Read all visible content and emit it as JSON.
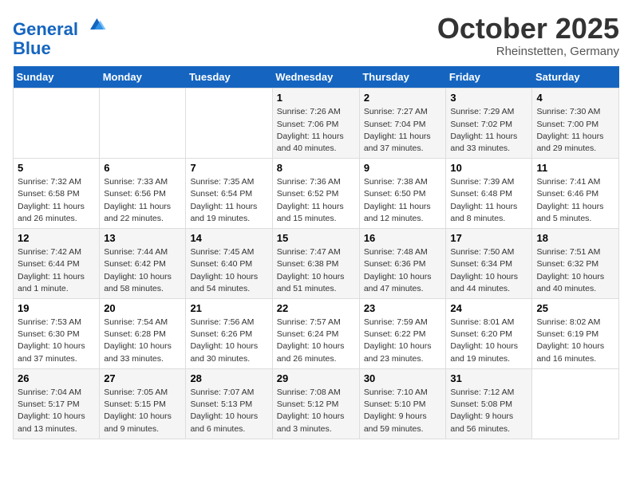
{
  "header": {
    "logo_line1": "General",
    "logo_line2": "Blue",
    "month_year": "October 2025",
    "location": "Rheinstetten, Germany"
  },
  "days_of_week": [
    "Sunday",
    "Monday",
    "Tuesday",
    "Wednesday",
    "Thursday",
    "Friday",
    "Saturday"
  ],
  "weeks": [
    [
      {
        "day": "",
        "info": ""
      },
      {
        "day": "",
        "info": ""
      },
      {
        "day": "",
        "info": ""
      },
      {
        "day": "1",
        "info": "Sunrise: 7:26 AM\nSunset: 7:06 PM\nDaylight: 11 hours and 40 minutes."
      },
      {
        "day": "2",
        "info": "Sunrise: 7:27 AM\nSunset: 7:04 PM\nDaylight: 11 hours and 37 minutes."
      },
      {
        "day": "3",
        "info": "Sunrise: 7:29 AM\nSunset: 7:02 PM\nDaylight: 11 hours and 33 minutes."
      },
      {
        "day": "4",
        "info": "Sunrise: 7:30 AM\nSunset: 7:00 PM\nDaylight: 11 hours and 29 minutes."
      }
    ],
    [
      {
        "day": "5",
        "info": "Sunrise: 7:32 AM\nSunset: 6:58 PM\nDaylight: 11 hours and 26 minutes."
      },
      {
        "day": "6",
        "info": "Sunrise: 7:33 AM\nSunset: 6:56 PM\nDaylight: 11 hours and 22 minutes."
      },
      {
        "day": "7",
        "info": "Sunrise: 7:35 AM\nSunset: 6:54 PM\nDaylight: 11 hours and 19 minutes."
      },
      {
        "day": "8",
        "info": "Sunrise: 7:36 AM\nSunset: 6:52 PM\nDaylight: 11 hours and 15 minutes."
      },
      {
        "day": "9",
        "info": "Sunrise: 7:38 AM\nSunset: 6:50 PM\nDaylight: 11 hours and 12 minutes."
      },
      {
        "day": "10",
        "info": "Sunrise: 7:39 AM\nSunset: 6:48 PM\nDaylight: 11 hours and 8 minutes."
      },
      {
        "day": "11",
        "info": "Sunrise: 7:41 AM\nSunset: 6:46 PM\nDaylight: 11 hours and 5 minutes."
      }
    ],
    [
      {
        "day": "12",
        "info": "Sunrise: 7:42 AM\nSunset: 6:44 PM\nDaylight: 11 hours and 1 minute."
      },
      {
        "day": "13",
        "info": "Sunrise: 7:44 AM\nSunset: 6:42 PM\nDaylight: 10 hours and 58 minutes."
      },
      {
        "day": "14",
        "info": "Sunrise: 7:45 AM\nSunset: 6:40 PM\nDaylight: 10 hours and 54 minutes."
      },
      {
        "day": "15",
        "info": "Sunrise: 7:47 AM\nSunset: 6:38 PM\nDaylight: 10 hours and 51 minutes."
      },
      {
        "day": "16",
        "info": "Sunrise: 7:48 AM\nSunset: 6:36 PM\nDaylight: 10 hours and 47 minutes."
      },
      {
        "day": "17",
        "info": "Sunrise: 7:50 AM\nSunset: 6:34 PM\nDaylight: 10 hours and 44 minutes."
      },
      {
        "day": "18",
        "info": "Sunrise: 7:51 AM\nSunset: 6:32 PM\nDaylight: 10 hours and 40 minutes."
      }
    ],
    [
      {
        "day": "19",
        "info": "Sunrise: 7:53 AM\nSunset: 6:30 PM\nDaylight: 10 hours and 37 minutes."
      },
      {
        "day": "20",
        "info": "Sunrise: 7:54 AM\nSunset: 6:28 PM\nDaylight: 10 hours and 33 minutes."
      },
      {
        "day": "21",
        "info": "Sunrise: 7:56 AM\nSunset: 6:26 PM\nDaylight: 10 hours and 30 minutes."
      },
      {
        "day": "22",
        "info": "Sunrise: 7:57 AM\nSunset: 6:24 PM\nDaylight: 10 hours and 26 minutes."
      },
      {
        "day": "23",
        "info": "Sunrise: 7:59 AM\nSunset: 6:22 PM\nDaylight: 10 hours and 23 minutes."
      },
      {
        "day": "24",
        "info": "Sunrise: 8:01 AM\nSunset: 6:20 PM\nDaylight: 10 hours and 19 minutes."
      },
      {
        "day": "25",
        "info": "Sunrise: 8:02 AM\nSunset: 6:19 PM\nDaylight: 10 hours and 16 minutes."
      }
    ],
    [
      {
        "day": "26",
        "info": "Sunrise: 7:04 AM\nSunset: 5:17 PM\nDaylight: 10 hours and 13 minutes."
      },
      {
        "day": "27",
        "info": "Sunrise: 7:05 AM\nSunset: 5:15 PM\nDaylight: 10 hours and 9 minutes."
      },
      {
        "day": "28",
        "info": "Sunrise: 7:07 AM\nSunset: 5:13 PM\nDaylight: 10 hours and 6 minutes."
      },
      {
        "day": "29",
        "info": "Sunrise: 7:08 AM\nSunset: 5:12 PM\nDaylight: 10 hours and 3 minutes."
      },
      {
        "day": "30",
        "info": "Sunrise: 7:10 AM\nSunset: 5:10 PM\nDaylight: 9 hours and 59 minutes."
      },
      {
        "day": "31",
        "info": "Sunrise: 7:12 AM\nSunset: 5:08 PM\nDaylight: 9 hours and 56 minutes."
      },
      {
        "day": "",
        "info": ""
      }
    ]
  ]
}
